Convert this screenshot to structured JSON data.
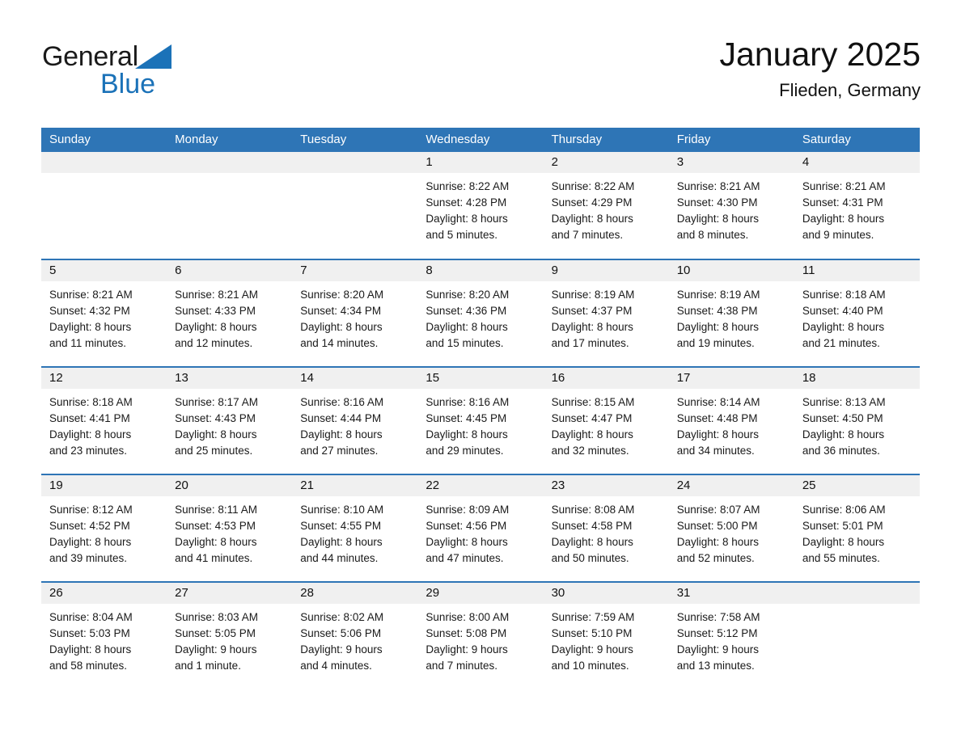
{
  "brand": {
    "name_part1": "General",
    "name_part2": "Blue",
    "triangle_color": "#1b72b8",
    "text_color": "#1a1a1a"
  },
  "header": {
    "title": "January 2025",
    "location": "Flieden, Germany"
  },
  "theme": {
    "header_bar_color": "#2e75b6",
    "daynum_band_color": "#f0f0f0",
    "row_divider_color": "#2e75b6",
    "text_color": "#1a1a1a"
  },
  "weekdays": [
    "Sunday",
    "Monday",
    "Tuesday",
    "Wednesday",
    "Thursday",
    "Friday",
    "Saturday"
  ],
  "weeks": [
    [
      {
        "day": "",
        "sunrise": "",
        "sunset": "",
        "daylight1": "",
        "daylight2": ""
      },
      {
        "day": "",
        "sunrise": "",
        "sunset": "",
        "daylight1": "",
        "daylight2": ""
      },
      {
        "day": "",
        "sunrise": "",
        "sunset": "",
        "daylight1": "",
        "daylight2": ""
      },
      {
        "day": "1",
        "sunrise": "Sunrise: 8:22 AM",
        "sunset": "Sunset: 4:28 PM",
        "daylight1": "Daylight: 8 hours",
        "daylight2": "and 5 minutes."
      },
      {
        "day": "2",
        "sunrise": "Sunrise: 8:22 AM",
        "sunset": "Sunset: 4:29 PM",
        "daylight1": "Daylight: 8 hours",
        "daylight2": "and 7 minutes."
      },
      {
        "day": "3",
        "sunrise": "Sunrise: 8:21 AM",
        "sunset": "Sunset: 4:30 PM",
        "daylight1": "Daylight: 8 hours",
        "daylight2": "and 8 minutes."
      },
      {
        "day": "4",
        "sunrise": "Sunrise: 8:21 AM",
        "sunset": "Sunset: 4:31 PM",
        "daylight1": "Daylight: 8 hours",
        "daylight2": "and 9 minutes."
      }
    ],
    [
      {
        "day": "5",
        "sunrise": "Sunrise: 8:21 AM",
        "sunset": "Sunset: 4:32 PM",
        "daylight1": "Daylight: 8 hours",
        "daylight2": "and 11 minutes."
      },
      {
        "day": "6",
        "sunrise": "Sunrise: 8:21 AM",
        "sunset": "Sunset: 4:33 PM",
        "daylight1": "Daylight: 8 hours",
        "daylight2": "and 12 minutes."
      },
      {
        "day": "7",
        "sunrise": "Sunrise: 8:20 AM",
        "sunset": "Sunset: 4:34 PM",
        "daylight1": "Daylight: 8 hours",
        "daylight2": "and 14 minutes."
      },
      {
        "day": "8",
        "sunrise": "Sunrise: 8:20 AM",
        "sunset": "Sunset: 4:36 PM",
        "daylight1": "Daylight: 8 hours",
        "daylight2": "and 15 minutes."
      },
      {
        "day": "9",
        "sunrise": "Sunrise: 8:19 AM",
        "sunset": "Sunset: 4:37 PM",
        "daylight1": "Daylight: 8 hours",
        "daylight2": "and 17 minutes."
      },
      {
        "day": "10",
        "sunrise": "Sunrise: 8:19 AM",
        "sunset": "Sunset: 4:38 PM",
        "daylight1": "Daylight: 8 hours",
        "daylight2": "and 19 minutes."
      },
      {
        "day": "11",
        "sunrise": "Sunrise: 8:18 AM",
        "sunset": "Sunset: 4:40 PM",
        "daylight1": "Daylight: 8 hours",
        "daylight2": "and 21 minutes."
      }
    ],
    [
      {
        "day": "12",
        "sunrise": "Sunrise: 8:18 AM",
        "sunset": "Sunset: 4:41 PM",
        "daylight1": "Daylight: 8 hours",
        "daylight2": "and 23 minutes."
      },
      {
        "day": "13",
        "sunrise": "Sunrise: 8:17 AM",
        "sunset": "Sunset: 4:43 PM",
        "daylight1": "Daylight: 8 hours",
        "daylight2": "and 25 minutes."
      },
      {
        "day": "14",
        "sunrise": "Sunrise: 8:16 AM",
        "sunset": "Sunset: 4:44 PM",
        "daylight1": "Daylight: 8 hours",
        "daylight2": "and 27 minutes."
      },
      {
        "day": "15",
        "sunrise": "Sunrise: 8:16 AM",
        "sunset": "Sunset: 4:45 PM",
        "daylight1": "Daylight: 8 hours",
        "daylight2": "and 29 minutes."
      },
      {
        "day": "16",
        "sunrise": "Sunrise: 8:15 AM",
        "sunset": "Sunset: 4:47 PM",
        "daylight1": "Daylight: 8 hours",
        "daylight2": "and 32 minutes."
      },
      {
        "day": "17",
        "sunrise": "Sunrise: 8:14 AM",
        "sunset": "Sunset: 4:48 PM",
        "daylight1": "Daylight: 8 hours",
        "daylight2": "and 34 minutes."
      },
      {
        "day": "18",
        "sunrise": "Sunrise: 8:13 AM",
        "sunset": "Sunset: 4:50 PM",
        "daylight1": "Daylight: 8 hours",
        "daylight2": "and 36 minutes."
      }
    ],
    [
      {
        "day": "19",
        "sunrise": "Sunrise: 8:12 AM",
        "sunset": "Sunset: 4:52 PM",
        "daylight1": "Daylight: 8 hours",
        "daylight2": "and 39 minutes."
      },
      {
        "day": "20",
        "sunrise": "Sunrise: 8:11 AM",
        "sunset": "Sunset: 4:53 PM",
        "daylight1": "Daylight: 8 hours",
        "daylight2": "and 41 minutes."
      },
      {
        "day": "21",
        "sunrise": "Sunrise: 8:10 AM",
        "sunset": "Sunset: 4:55 PM",
        "daylight1": "Daylight: 8 hours",
        "daylight2": "and 44 minutes."
      },
      {
        "day": "22",
        "sunrise": "Sunrise: 8:09 AM",
        "sunset": "Sunset: 4:56 PM",
        "daylight1": "Daylight: 8 hours",
        "daylight2": "and 47 minutes."
      },
      {
        "day": "23",
        "sunrise": "Sunrise: 8:08 AM",
        "sunset": "Sunset: 4:58 PM",
        "daylight1": "Daylight: 8 hours",
        "daylight2": "and 50 minutes."
      },
      {
        "day": "24",
        "sunrise": "Sunrise: 8:07 AM",
        "sunset": "Sunset: 5:00 PM",
        "daylight1": "Daylight: 8 hours",
        "daylight2": "and 52 minutes."
      },
      {
        "day": "25",
        "sunrise": "Sunrise: 8:06 AM",
        "sunset": "Sunset: 5:01 PM",
        "daylight1": "Daylight: 8 hours",
        "daylight2": "and 55 minutes."
      }
    ],
    [
      {
        "day": "26",
        "sunrise": "Sunrise: 8:04 AM",
        "sunset": "Sunset: 5:03 PM",
        "daylight1": "Daylight: 8 hours",
        "daylight2": "and 58 minutes."
      },
      {
        "day": "27",
        "sunrise": "Sunrise: 8:03 AM",
        "sunset": "Sunset: 5:05 PM",
        "daylight1": "Daylight: 9 hours",
        "daylight2": "and 1 minute."
      },
      {
        "day": "28",
        "sunrise": "Sunrise: 8:02 AM",
        "sunset": "Sunset: 5:06 PM",
        "daylight1": "Daylight: 9 hours",
        "daylight2": "and 4 minutes."
      },
      {
        "day": "29",
        "sunrise": "Sunrise: 8:00 AM",
        "sunset": "Sunset: 5:08 PM",
        "daylight1": "Daylight: 9 hours",
        "daylight2": "and 7 minutes."
      },
      {
        "day": "30",
        "sunrise": "Sunrise: 7:59 AM",
        "sunset": "Sunset: 5:10 PM",
        "daylight1": "Daylight: 9 hours",
        "daylight2": "and 10 minutes."
      },
      {
        "day": "31",
        "sunrise": "Sunrise: 7:58 AM",
        "sunset": "Sunset: 5:12 PM",
        "daylight1": "Daylight: 9 hours",
        "daylight2": "and 13 minutes."
      },
      {
        "day": "",
        "sunrise": "",
        "sunset": "",
        "daylight1": "",
        "daylight2": ""
      }
    ]
  ]
}
